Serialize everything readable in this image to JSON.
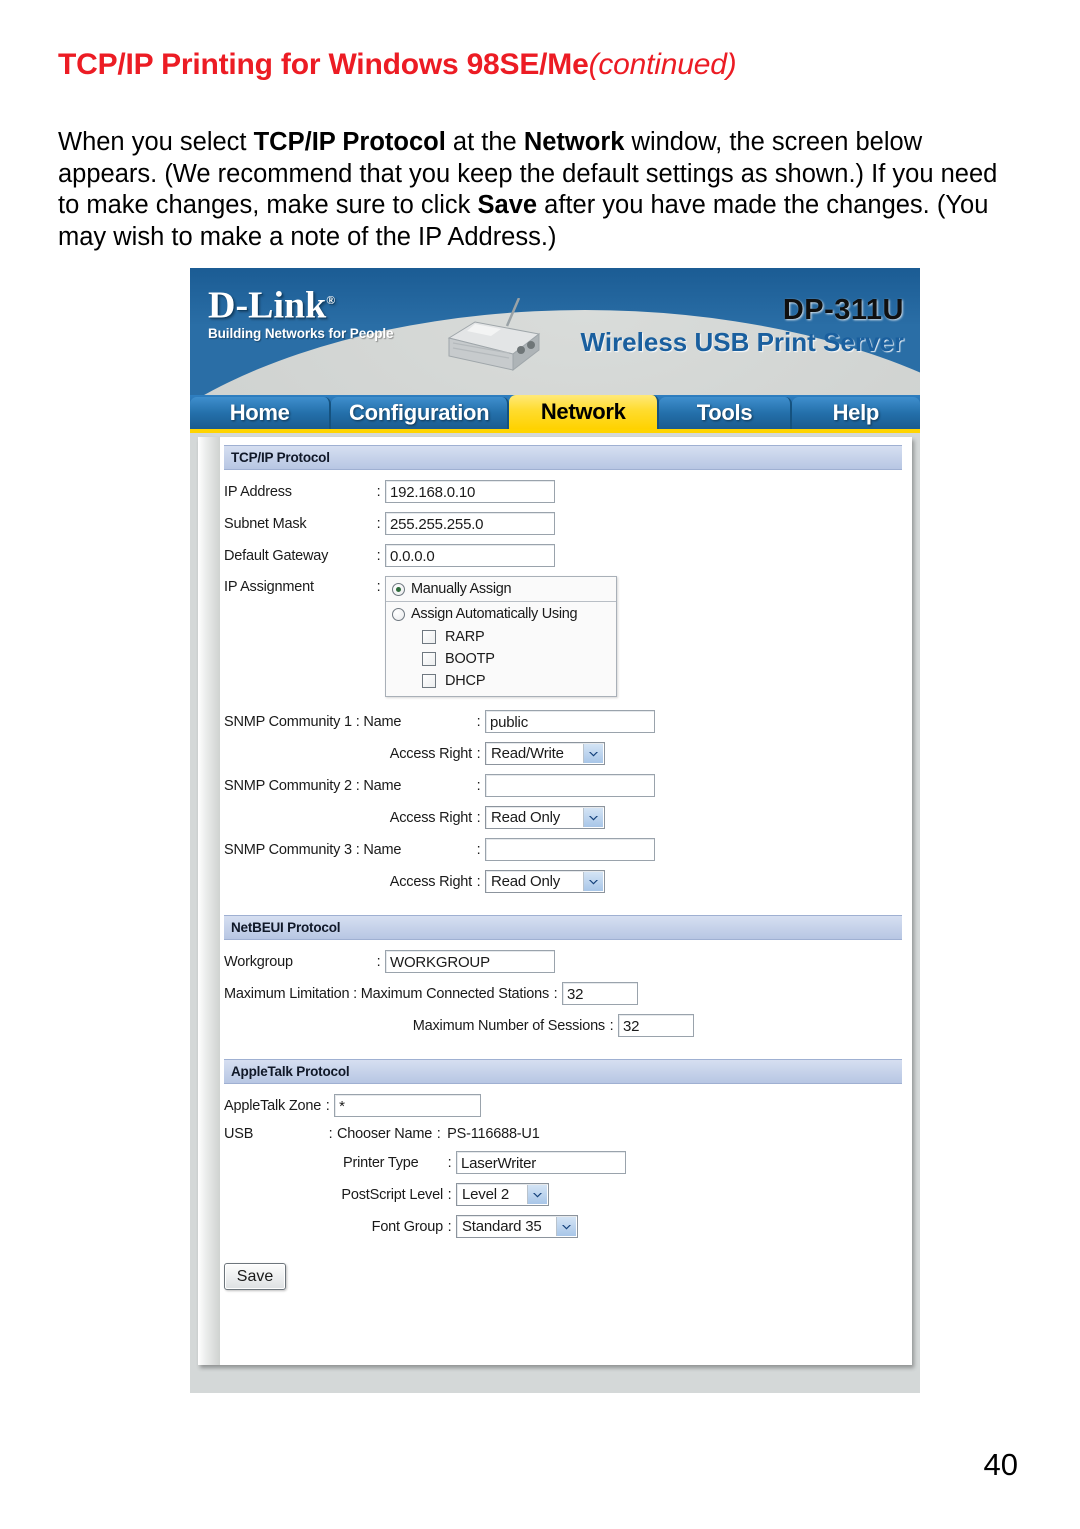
{
  "document": {
    "title_main": "TCP/IP Printing for Windows 98SE/Me",
    "title_continued": "(continued)",
    "title_color": "#ec1c24",
    "paragraph_parts": [
      {
        "text": "When you select ",
        "bold": false
      },
      {
        "text": "TCP/IP Protocol",
        "bold": true
      },
      {
        "text": " at the ",
        "bold": false
      },
      {
        "text": "Network",
        "bold": true
      },
      {
        "text": " window, the screen below appears.  (We recommend that you keep the default settings as shown.)  If you need to make changes, make sure to click ",
        "bold": false
      },
      {
        "text": "Save",
        "bold": true
      },
      {
        "text": " after you have made the changes. (You may wish to make a note of the IP Address.)",
        "bold": false
      }
    ],
    "page_number": "40"
  },
  "banner": {
    "logo_text": "D-Link",
    "logo_trademark": "®",
    "logo_tagline": "Building Networks for People",
    "model": "DP-311U",
    "tagline": "Wireless USB Print Server",
    "blue": "#2a6ea6",
    "gray": "#cfd2d0",
    "tagline_color": "#1a5f9e"
  },
  "nav": {
    "tabs": [
      {
        "label": "Home",
        "active": false
      },
      {
        "label": "Configuration",
        "active": false
      },
      {
        "label": "Network",
        "active": true
      },
      {
        "label": "Tools",
        "active": false
      },
      {
        "label": "Help",
        "active": false
      }
    ],
    "active_bg": "#ffd200",
    "inactive_bg": "#2470ab",
    "underline": "#ffd400"
  },
  "tcpip": {
    "section_title": "TCP/IP Protocol",
    "ip_address_label": "IP Address",
    "ip_address_value": "192.168.0.10",
    "subnet_mask_label": "Subnet Mask",
    "subnet_mask_value": "255.255.255.0",
    "default_gateway_label": "Default Gateway",
    "default_gateway_value": "0.0.0.0",
    "ip_assignment_label": "IP Assignment",
    "manual_option": "Manually Assign",
    "manual_selected": true,
    "auto_option": "Assign Automatically Using",
    "auto_selected": false,
    "auto_methods": [
      {
        "label": "RARP",
        "checked": false
      },
      {
        "label": "BOOTP",
        "checked": false
      },
      {
        "label": "DHCP",
        "checked": false
      }
    ],
    "communities": [
      {
        "name_label": "SNMP Community 1 : Name",
        "name_value": "public",
        "access_label": "Access Right",
        "access_value": "Read/Write"
      },
      {
        "name_label": "SNMP Community 2 : Name",
        "name_value": "",
        "access_label": "Access Right",
        "access_value": "Read Only"
      },
      {
        "name_label": "SNMP Community 3 : Name",
        "name_value": "",
        "access_label": "Access Right",
        "access_value": "Read Only"
      }
    ]
  },
  "netbeui": {
    "section_title": "NetBEUI Protocol",
    "workgroup_label": "Workgroup",
    "workgroup_value": "WORKGROUP",
    "max_limitation_label": "Maximum Limitation : Maximum Connected Stations",
    "max_stations_value": "32",
    "max_sessions_label": "Maximum Number of Sessions",
    "max_sessions_value": "32"
  },
  "appletalk": {
    "section_title": "AppleTalk Protocol",
    "zone_label": "AppleTalk Zone",
    "zone_value": "*",
    "usb_label": "USB",
    "chooser_name_label": "Chooser Name",
    "chooser_name_value": "PS-116688-U1",
    "printer_type_label": "Printer Type",
    "printer_type_value": "LaserWriter",
    "postscript_label": "PostScript Level",
    "postscript_value": "Level 2",
    "font_group_label": "Font Group",
    "font_group_value": "Standard 35"
  },
  "actions": {
    "save_label": "Save"
  }
}
